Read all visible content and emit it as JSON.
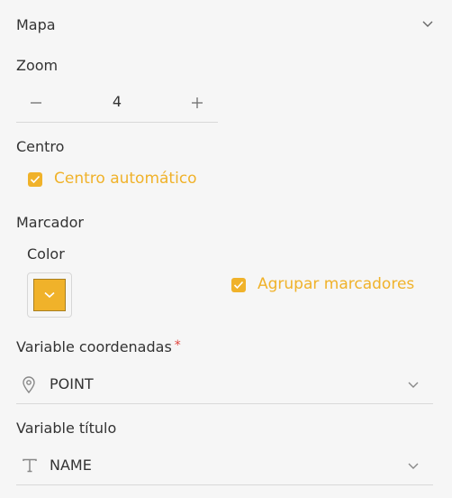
{
  "header": {
    "title": "Mapa",
    "collapse_icon": "chevron-down-icon"
  },
  "zoom": {
    "label": "Zoom",
    "value": "4",
    "decrement_icon": "minus-icon",
    "increment_icon": "plus-icon"
  },
  "centro": {
    "label": "Centro",
    "auto_label": "Centro automático",
    "auto_checked": true
  },
  "marcador": {
    "label": "Marcador",
    "color_label": "Color",
    "color_value": "#f0b22a",
    "group_label": "Agrupar marcadores",
    "group_checked": true
  },
  "coord_var": {
    "label": "Variable coordenadas",
    "required_mark": "*",
    "value": "POINT",
    "icon": "location-pin-icon"
  },
  "title_var": {
    "label": "Variable título",
    "value": "NAME",
    "icon": "text-type-icon"
  },
  "colors": {
    "accent": "#f0b22a",
    "required": "#e0443c"
  }
}
